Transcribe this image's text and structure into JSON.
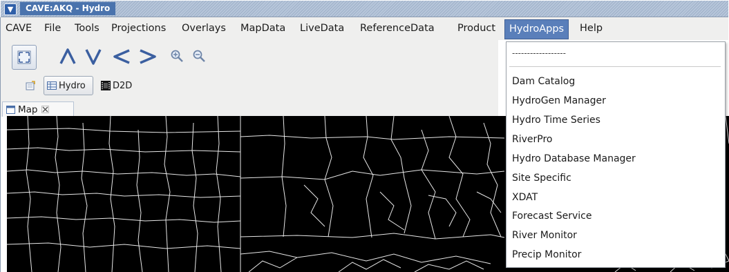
{
  "window": {
    "title": "CAVE:AKQ - Hydro",
    "icon": "chevron-down-icon"
  },
  "menubar": {
    "items": [
      "CAVE",
      "File",
      "Tools",
      "Projections",
      "Overlays",
      "MapData",
      "LiveData",
      "ReferenceData",
      "Product",
      "HydroApps",
      "Help"
    ],
    "active": "HydroApps"
  },
  "toolbar": {
    "buttons": [
      "fullscreen-icon",
      "arrow-up-icon",
      "arrow-down-icon",
      "arrow-left-icon",
      "arrow-right-icon",
      "zoom-in-icon",
      "zoom-out-icon"
    ]
  },
  "perspectives": [
    {
      "label": "Hydro",
      "icon": "table-icon"
    },
    {
      "label": "D2D",
      "icon": "film-icon"
    }
  ],
  "editor_tabs": [
    {
      "label": "Map",
      "icon": "window-icon",
      "close_icon": "close-icon"
    }
  ],
  "dropdown": {
    "separator_text": "------------------",
    "items": [
      "Dam Catalog",
      "HydroGen Manager",
      "Hydro Time Series",
      "RiverPro",
      "Hydro Database Manager",
      "Site Specific",
      "XDAT",
      "Forecast Service",
      "River Monitor",
      "Precip Monitor"
    ]
  },
  "colors": {
    "titlebar_bg": "#b7c6da",
    "menu_active_bg": "#5a7fba",
    "map_bg": "#000000",
    "map_lines": "#e8e8e8"
  }
}
